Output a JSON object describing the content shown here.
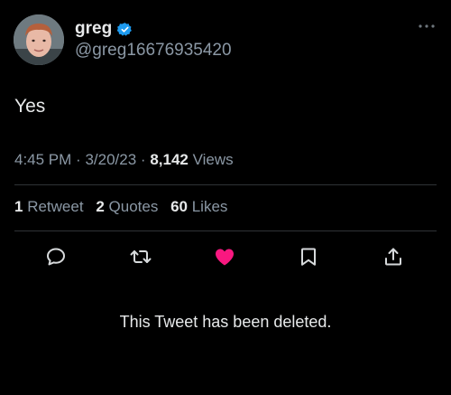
{
  "user": {
    "display_name": "greg",
    "handle": "@greg16676935420",
    "verified": true,
    "verified_color": "#1d9bf0"
  },
  "tweet": {
    "text": "Yes",
    "time": "4:45 PM",
    "separator": "·",
    "date": "3/20/23",
    "views_count": "8,142",
    "views_label": "Views"
  },
  "stats": {
    "retweets_count": "1",
    "retweets_label": "Retweet",
    "quotes_count": "2",
    "quotes_label": "Quotes",
    "likes_count": "60",
    "likes_label": "Likes"
  },
  "actions": {
    "icons": [
      "reply-icon",
      "retweet-icon",
      "like-icon",
      "bookmark-icon",
      "share-icon"
    ],
    "liked": true,
    "like_color": "#f91880"
  },
  "notice": {
    "deleted_text": "This Tweet has been deleted."
  },
  "colors": {
    "background": "#000000",
    "text_primary": "#e7e9ea",
    "text_secondary": "#8b98a5",
    "divider": "#2f3336"
  }
}
